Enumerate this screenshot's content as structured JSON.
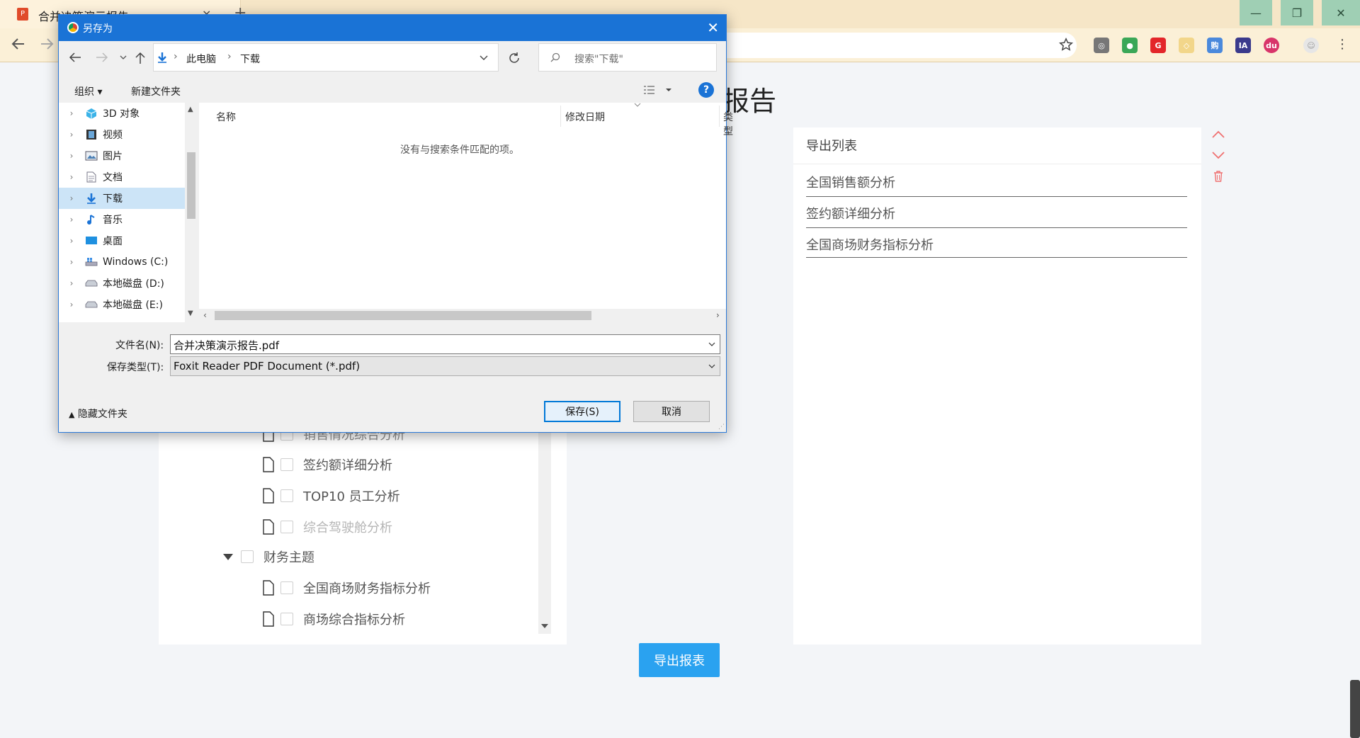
{
  "browser": {
    "tab_title": "合并决策演示报告",
    "tab_close": "×",
    "new_tab": "+"
  },
  "page": {
    "title_visible": "报告",
    "export_list": {
      "header": "导出列表",
      "items": [
        "全国销售额分析",
        "签约额详细分析",
        "全国商场财务指标分析"
      ]
    },
    "tree": {
      "partial_item": "销售情况综合分析",
      "items_a": [
        {
          "label": "签约额详细分析",
          "muted": false
        },
        {
          "label": "TOP10 员工分析",
          "muted": false
        },
        {
          "label": "综合驾驶舱分析",
          "muted": true
        }
      ],
      "group": "财务主题",
      "items_b": [
        {
          "label": "全国商场财务指标分析"
        },
        {
          "label": "商场综合指标分析"
        }
      ]
    },
    "export_button": "导出报表"
  },
  "dialog": {
    "title": "另存为",
    "breadcrumb": [
      "此电脑",
      "下载"
    ],
    "search_placeholder": "搜索\"下载\"",
    "organize": "组织",
    "new_folder": "新建文件夹",
    "nav_items": [
      {
        "label": "3D 对象",
        "icon": "cube-icon"
      },
      {
        "label": "视频",
        "icon": "film-icon"
      },
      {
        "label": "图片",
        "icon": "picture-icon"
      },
      {
        "label": "文档",
        "icon": "document-icon"
      },
      {
        "label": "下载",
        "icon": "download-icon",
        "selected": true
      },
      {
        "label": "音乐",
        "icon": "music-icon"
      },
      {
        "label": "桌面",
        "icon": "desktop-icon"
      },
      {
        "label": "Windows (C:)",
        "icon": "windows-drive-icon"
      },
      {
        "label": "本地磁盘 (D:)",
        "icon": "drive-icon"
      },
      {
        "label": "本地磁盘 (E:)",
        "icon": "drive-icon"
      }
    ],
    "columns": {
      "name": "名称",
      "modified": "修改日期",
      "type": "类型"
    },
    "empty_message": "没有与搜索条件匹配的项。",
    "filename_label": "文件名(N):",
    "filename_value": "合并决策演示报告.pdf",
    "filetype_label": "保存类型(T):",
    "filetype_value": "Foxit Reader PDF Document (*.pdf)",
    "hide_folders": "隐藏文件夹",
    "save_button": "保存(S)",
    "cancel_button": "取消"
  },
  "colors": {
    "dialog_title_bar": "#1a73d6",
    "primary_button": "#2aa2f0",
    "danger_icon": "#f07070"
  }
}
